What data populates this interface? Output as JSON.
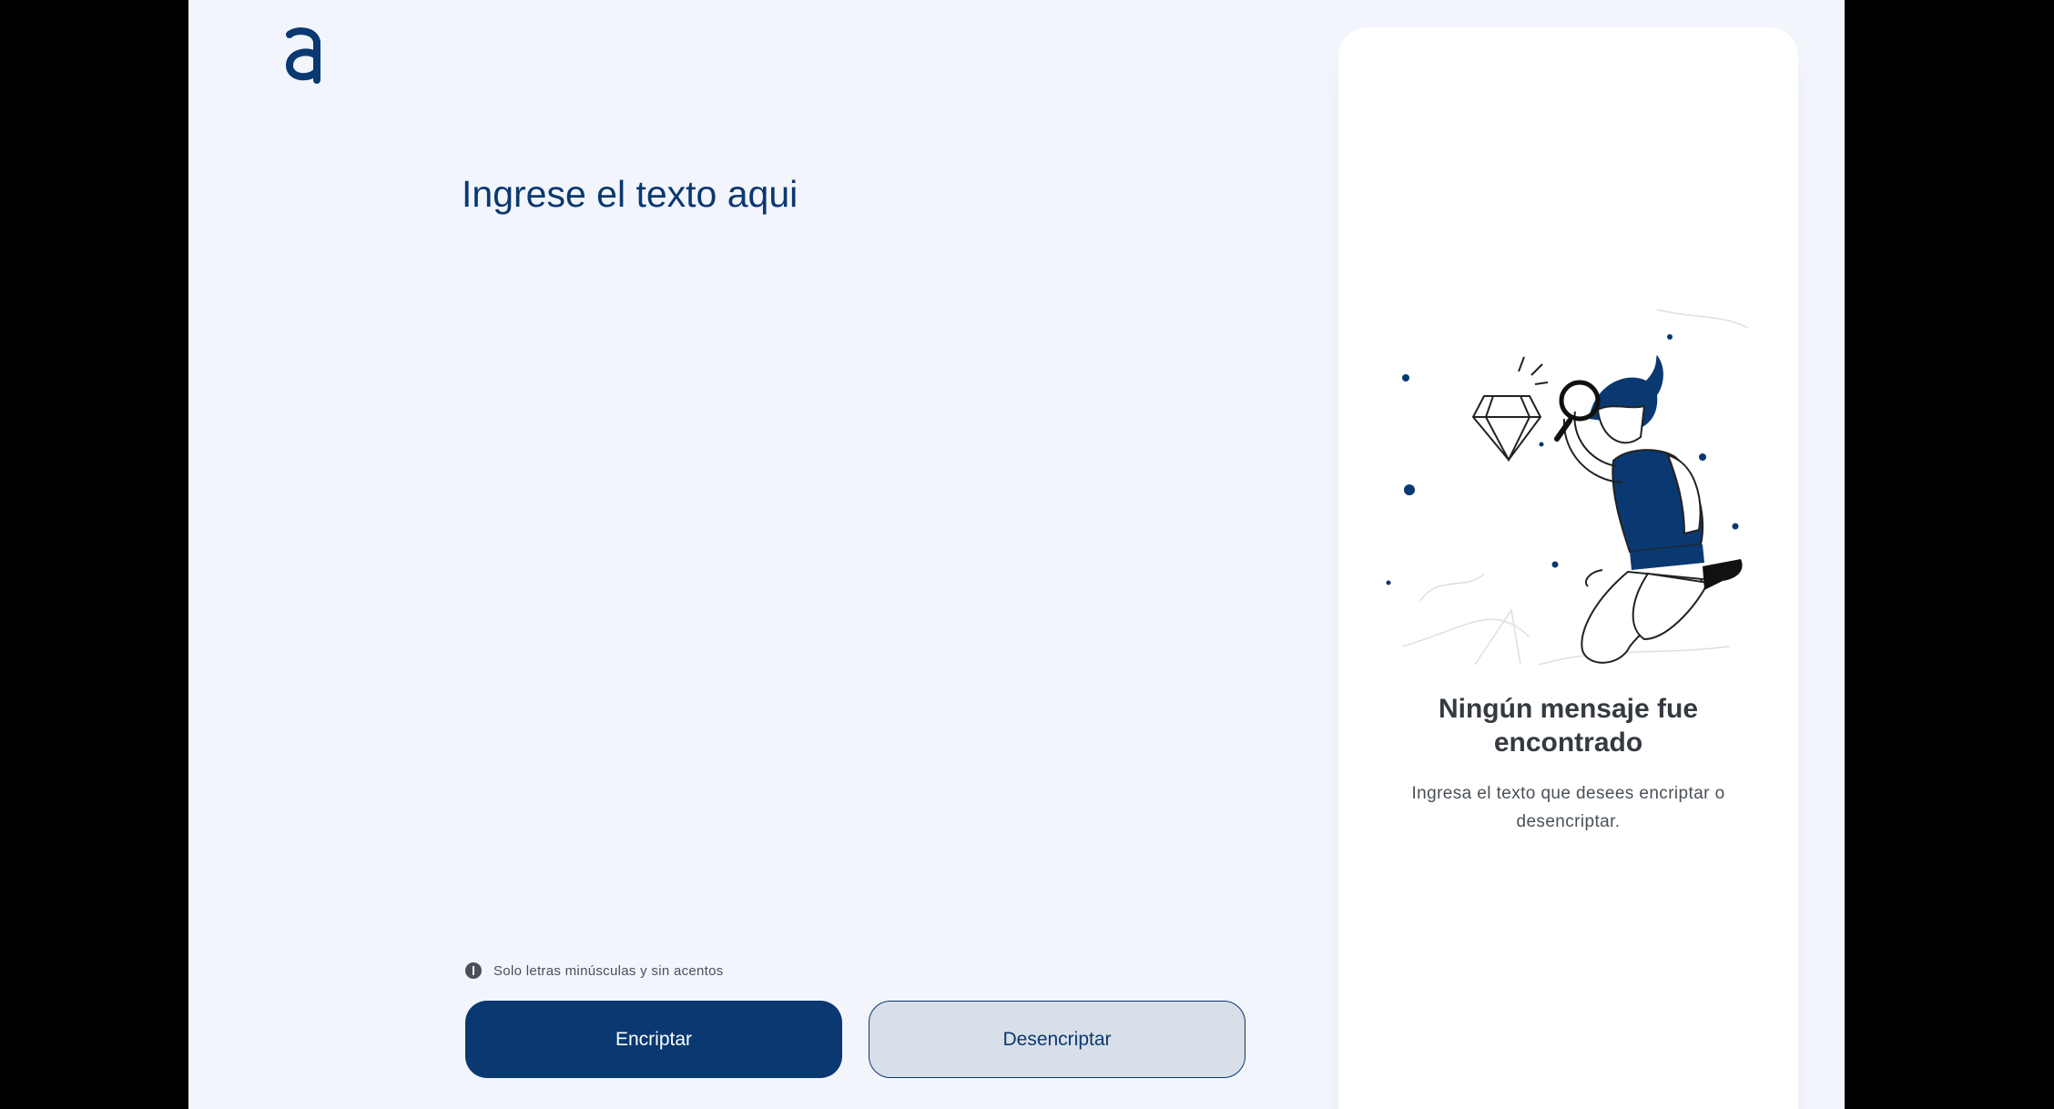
{
  "logo": {
    "icon": "alura-a-logo-icon",
    "color": "#0a3871"
  },
  "editor": {
    "placeholder": "Ingrese el texto aqui",
    "value": ""
  },
  "hint": {
    "icon": "info-circle-icon",
    "text": "Solo letras minúsculas y sin acentos"
  },
  "actions": {
    "encrypt_label": "Encriptar",
    "decrypt_label": "Desencriptar"
  },
  "output_panel": {
    "illustration": "boy-magnifying-glass-diamond-illustration",
    "title": "Ningún mensaje fue encontrado",
    "subtitle": "Ingresa el texto que desees encriptar o desencriptar."
  },
  "colors": {
    "primary": "#0a3871",
    "background": "#f3f5fc",
    "panel": "#ffffff",
    "secondary_button": "#d8dfe8",
    "title_text": "#343a40",
    "body_text": "#495057"
  }
}
